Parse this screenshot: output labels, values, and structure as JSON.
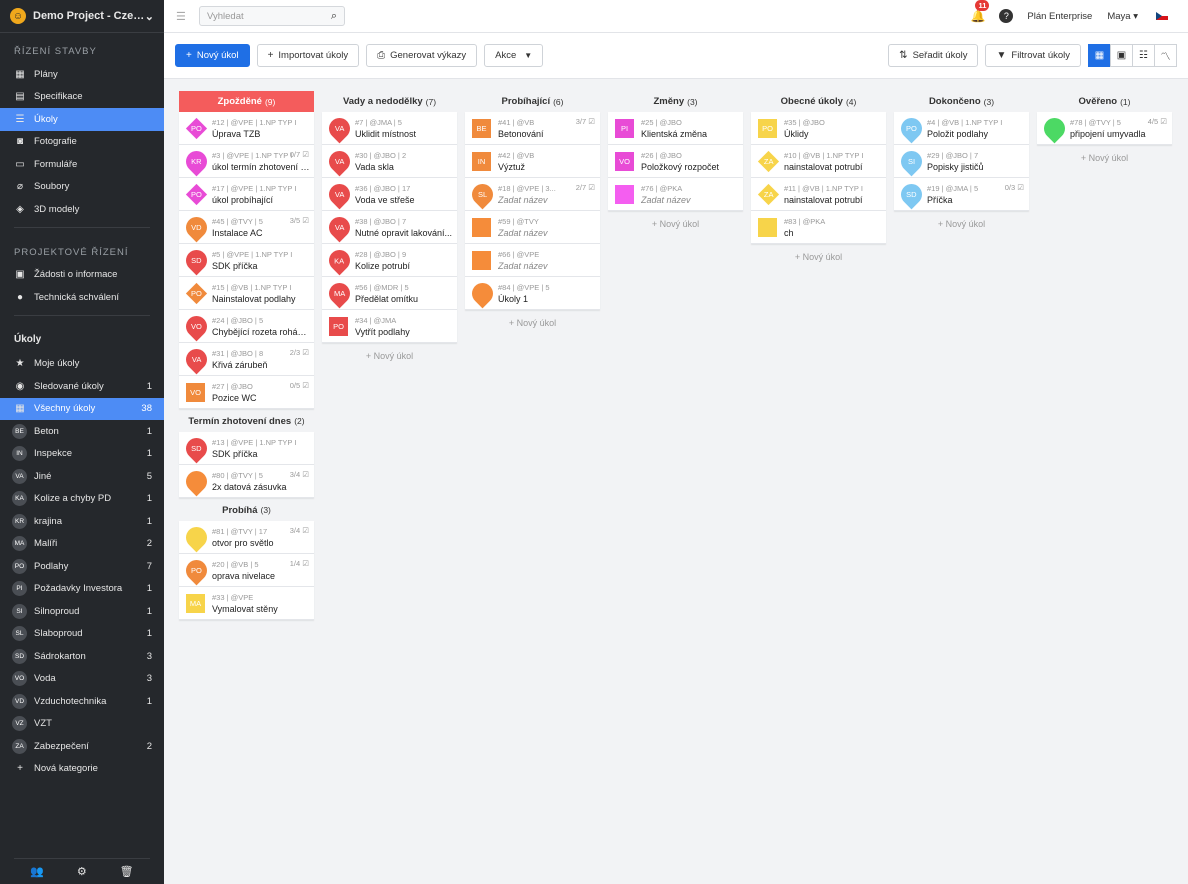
{
  "sidebar": {
    "project": "Demo Project - Cze…",
    "section1": "Řízení stavby",
    "section2": "Projektové řízení",
    "section3": "Úkoly",
    "nav1": [
      {
        "label": "Plány",
        "icon": "plans-icon",
        "glyph": "▦"
      },
      {
        "label": "Specifikace",
        "icon": "specs-icon",
        "glyph": "▤"
      },
      {
        "label": "Úkoly",
        "icon": "tasks-icon",
        "glyph": "☰",
        "active": true
      },
      {
        "label": "Fotografie",
        "icon": "camera-icon",
        "glyph": "◙"
      },
      {
        "label": "Formuláře",
        "icon": "forms-icon",
        "glyph": "▭"
      },
      {
        "label": "Soubory",
        "icon": "paperclip-icon",
        "glyph": "⌀"
      },
      {
        "label": "3D modely",
        "icon": "cube-icon",
        "glyph": "◈"
      }
    ],
    "nav2": [
      {
        "label": "Žádosti o informace",
        "icon": "rfi-icon",
        "glyph": "▣"
      },
      {
        "label": "Technická schválení",
        "icon": "person-icon",
        "glyph": "●"
      }
    ],
    "nav3": [
      {
        "label": "Moje úkoly",
        "icon": "star-icon",
        "glyph": "★",
        "count": ""
      },
      {
        "label": "Sledované úkoly",
        "icon": "eye-icon",
        "glyph": "◉",
        "count": "1"
      },
      {
        "label": "Všechny úkoly",
        "icon": "grid-icon",
        "glyph": "▦",
        "count": "38",
        "active": true
      }
    ],
    "categories": [
      {
        "abbr": "BE",
        "label": "Beton",
        "count": "1"
      },
      {
        "abbr": "IN",
        "label": "Inspekce",
        "count": "1"
      },
      {
        "abbr": "VA",
        "label": "Jiné",
        "count": "5"
      },
      {
        "abbr": "KA",
        "label": "Kolize a chyby PD",
        "count": "1"
      },
      {
        "abbr": "KR",
        "label": "krajina",
        "count": "1"
      },
      {
        "abbr": "MA",
        "label": "Malíři",
        "count": "2"
      },
      {
        "abbr": "PO",
        "label": "Podlahy",
        "count": "7"
      },
      {
        "abbr": "PI",
        "label": "Požadavky Investora",
        "count": "1"
      },
      {
        "abbr": "SI",
        "label": "Silnoproud",
        "count": "1"
      },
      {
        "abbr": "SL",
        "label": "Slaboproud",
        "count": "1"
      },
      {
        "abbr": "SD",
        "label": "Sádrokarton",
        "count": "3"
      },
      {
        "abbr": "VO",
        "label": "Voda",
        "count": "3"
      },
      {
        "abbr": "VD",
        "label": "Vzduchotechnika",
        "count": "1"
      },
      {
        "abbr": "VZ",
        "label": "VZT",
        "count": ""
      },
      {
        "abbr": "ZA",
        "label": "Zabezpečení",
        "count": "2"
      }
    ],
    "new_category": "Nová kategorie"
  },
  "topbar": {
    "search_placeholder": "Vyhledat",
    "notifications": "11",
    "plan": "Plán Enterprise",
    "user": "Maya"
  },
  "toolbar": {
    "new_task": "Nový úkol",
    "import": "Importovat úkoly",
    "reports": "Generovat výkazy",
    "actions": "Akce",
    "sort": "Seřadit úkoly",
    "filter": "Filtrovat úkoly"
  },
  "add_task": "+ Nový úkol",
  "columns": [
    {
      "title": "Zpožděné",
      "count": "(9)",
      "red": true,
      "groups": [
        {
          "cards": [
            {
              "mk": "diamond",
              "abbr": "PO",
              "color": "#e84bd6",
              "meta": "#12 | @VPE | 1.NP TYP I",
              "title": "Úprava TZB"
            },
            {
              "mk": "pin",
              "abbr": "KR",
              "color": "#e84bd6",
              "meta": "#3 | @VPE | 1.NP TYP I",
              "title": "úkol termín zhotovení dnes",
              "chk": "0/7 ☑"
            },
            {
              "mk": "diamond",
              "abbr": "PO",
              "color": "#e84bd6",
              "meta": "#17 | @VPE | 1.NP TYP I",
              "title": "úkol probíhající"
            },
            {
              "mk": "pin",
              "abbr": "VD",
              "color": "#f08a3c",
              "meta": "#45 | @TVY | 5",
              "title": "Instalace AC",
              "chk": "3/5 ☑"
            },
            {
              "mk": "pin",
              "abbr": "SD",
              "color": "#e84b4b",
              "meta": "#5 | @VPE | 1.NP TYP I",
              "title": "SDK příčka"
            },
            {
              "mk": "diamond",
              "abbr": "PO",
              "color": "#f08a3c",
              "meta": "#15 | @VB | 1.NP TYP I",
              "title": "Nainstalovat podlahy"
            },
            {
              "mk": "pin",
              "abbr": "VO",
              "color": "#e84b4b",
              "meta": "#24 | @JBO | 5",
              "title": "Chybějící rozeta roháčku"
            },
            {
              "mk": "pin",
              "abbr": "VA",
              "color": "#e84b4b",
              "meta": "#31 | @JBO | 8",
              "title": "Křivá zárubeň",
              "chk": "2/3 ☑"
            },
            {
              "mk": "sq",
              "abbr": "VO",
              "color": "#f08a3c",
              "meta": "#27 | @JBO",
              "title": "Pozice WC",
              "chk": "0/5 ☑"
            }
          ]
        },
        {
          "title": "Termín zhotovení dnes",
          "count": "(2)",
          "cards": [
            {
              "mk": "pin",
              "abbr": "SD",
              "color": "#e84b4b",
              "meta": "#13 | @VPE | 1.NP TYP I",
              "title": "SDK příčka"
            },
            {
              "mk": "pin",
              "abbr": "",
              "color": "#f58c3a",
              "meta": "#80 | @TVY | 5",
              "title": "2x datová zásuvka",
              "chk": "3/4 ☑"
            }
          ]
        },
        {
          "title": "Probíhá",
          "count": "(3)",
          "cards": [
            {
              "mk": "pin",
              "abbr": "",
              "color": "#f7d44a",
              "meta": "#81 | @TVY | 17",
              "title": "otvor pro světlo",
              "chk": "3/4 ☑"
            },
            {
              "mk": "pin",
              "abbr": "PO",
              "color": "#f08a3c",
              "meta": "#20 | @VB | 5",
              "title": "oprava nivelace",
              "chk": "1/4 ☑"
            },
            {
              "mk": "sq",
              "abbr": "MA",
              "color": "#f7d44a",
              "meta": "#33 | @VPE",
              "title": "Vymalovat stěny"
            }
          ]
        }
      ]
    },
    {
      "title": "Vady a nedodělky",
      "count": "(7)",
      "groups": [
        {
          "cards": [
            {
              "mk": "pin",
              "abbr": "VA",
              "color": "#e84b4b",
              "meta": "#7 | @JMA | 5",
              "title": "Uklidit místnost"
            },
            {
              "mk": "pin",
              "abbr": "VA",
              "color": "#e84b4b",
              "meta": "#30 | @JBO | 2",
              "title": "Vada skla"
            },
            {
              "mk": "pin",
              "abbr": "VA",
              "color": "#e84b4b",
              "meta": "#36 | @JBO | 17",
              "title": "Voda ve střeše"
            },
            {
              "mk": "pin",
              "abbr": "VA",
              "color": "#e84b4b",
              "meta": "#38 | @JBO | 7",
              "title": "Nutné opravit lakování..."
            },
            {
              "mk": "pin",
              "abbr": "KA",
              "color": "#e84b4b",
              "meta": "#28 | @JBO | 9",
              "title": "Kolize potrubí"
            },
            {
              "mk": "pin",
              "abbr": "MA",
              "color": "#e84b4b",
              "meta": "#56 | @MDR | 5",
              "title": "Předělat omítku"
            },
            {
              "mk": "sq",
              "abbr": "PO",
              "color": "#e84b4b",
              "meta": "#34 | @JMA",
              "title": "Vytřít podlahy"
            }
          ]
        }
      ]
    },
    {
      "title": "Probíhající",
      "count": "(6)",
      "groups": [
        {
          "cards": [
            {
              "mk": "sq",
              "abbr": "BE",
              "color": "#f08a3c",
              "meta": "#41 | @VB",
              "title": "Betonování",
              "chk": "3/7 ☑"
            },
            {
              "mk": "sq",
              "abbr": "IN",
              "color": "#f08a3c",
              "meta": "#42 | @VB",
              "title": "Výztuž"
            },
            {
              "mk": "pin",
              "abbr": "SL",
              "color": "#f08a3c",
              "meta": "#18 | @VPE | 3...",
              "title": "Zadat název",
              "it": true,
              "chk": "2/7 ☑"
            },
            {
              "mk": "sq",
              "abbr": "",
              "color": "#f58c3a",
              "meta": "#59 | @TVY",
              "title": "Zadat název",
              "it": true
            },
            {
              "mk": "sq",
              "abbr": "",
              "color": "#f58c3a",
              "meta": "#66 | @VPE",
              "title": "Zadat název",
              "it": true
            },
            {
              "mk": "pin",
              "abbr": "",
              "color": "#f58c3a",
              "meta": "#84 | @VPE | 5",
              "title": "Úkoly 1"
            }
          ]
        }
      ]
    },
    {
      "title": "Změny",
      "count": "(3)",
      "groups": [
        {
          "cards": [
            {
              "mk": "sq",
              "abbr": "PI",
              "color": "#e84bd6",
              "meta": "#25 | @JBO",
              "title": "Klientská změna"
            },
            {
              "mk": "sq",
              "abbr": "VO",
              "color": "#e84bd6",
              "meta": "#26 | @JBO",
              "title": "Položkový rozpočet"
            },
            {
              "mk": "sq",
              "abbr": "",
              "color": "#f45ef0",
              "meta": "#76 | @PKA",
              "title": "Zadat název",
              "it": true
            }
          ]
        }
      ]
    },
    {
      "title": "Obecné úkoly",
      "count": "(4)",
      "groups": [
        {
          "cards": [
            {
              "mk": "sq",
              "abbr": "PO",
              "color": "#f7d44a",
              "meta": "#35 | @JBO",
              "title": "Úklidy"
            },
            {
              "mk": "diamond",
              "abbr": "ZA",
              "color": "#f7d44a",
              "meta": "#10 | @VB | 1.NP TYP I",
              "title": "nainstalovat potrubí"
            },
            {
              "mk": "diamond",
              "abbr": "ZA",
              "color": "#f7d44a",
              "meta": "#11 | @VB | 1.NP TYP I",
              "title": "nainstalovat potrubí"
            },
            {
              "mk": "sq",
              "abbr": "",
              "color": "#f7d44a",
              "meta": "#83 | @PKA",
              "title": "ch"
            }
          ]
        }
      ]
    },
    {
      "title": "Dokončeno",
      "count": "(3)",
      "groups": [
        {
          "cards": [
            {
              "mk": "pin",
              "abbr": "PO",
              "color": "#7ec8f2",
              "meta": "#4 | @VB | 1.NP TYP I",
              "title": "Položit podlahy"
            },
            {
              "mk": "pin",
              "abbr": "SI",
              "color": "#7ec8f2",
              "meta": "#29 | @JBO | 7",
              "title": "Popisky jističů"
            },
            {
              "mk": "pin",
              "abbr": "SD",
              "color": "#7ec8f2",
              "meta": "#19 | @JMA | 5",
              "title": "Příčka",
              "chk": "0/3 ☑"
            }
          ]
        }
      ]
    },
    {
      "title": "Ověřeno",
      "count": "(1)",
      "groups": [
        {
          "cards": [
            {
              "mk": "pin",
              "abbr": "",
              "color": "#4cd964",
              "meta": "#78 | @TVY | 5",
              "title": "připojení umyvadla",
              "chk": "4/5 ☑"
            }
          ]
        }
      ]
    }
  ],
  "colors": {
    "accent": "#1f6fe5",
    "sidebar": "#25282c",
    "overdue": "#f45c5c"
  }
}
